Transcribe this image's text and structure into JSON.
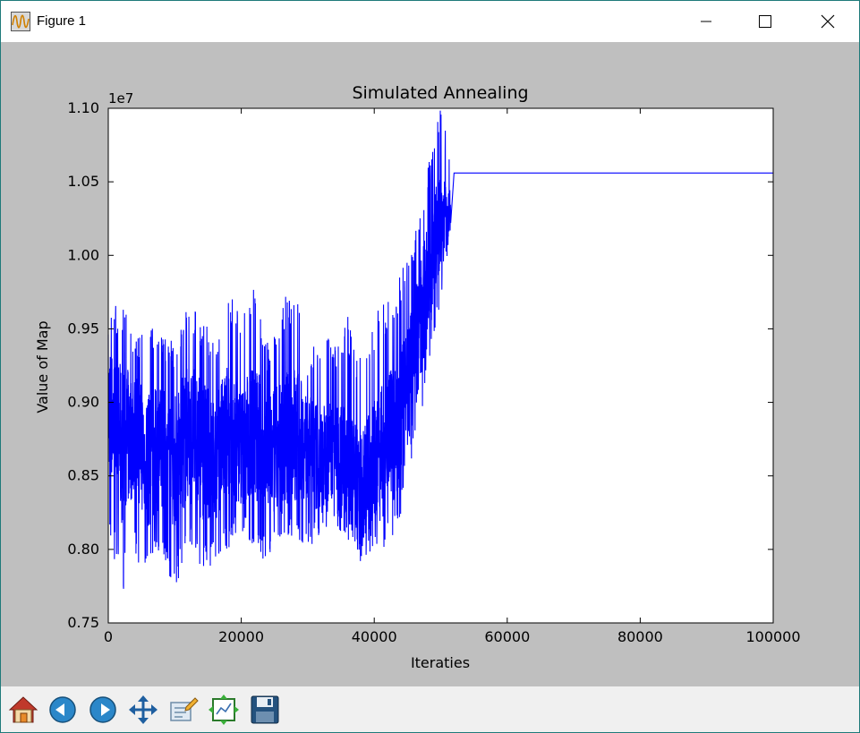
{
  "window": {
    "title": "Figure 1",
    "controls": [
      "minimize",
      "maximize",
      "close"
    ]
  },
  "toolbar": {
    "buttons": [
      {
        "name": "home-icon"
      },
      {
        "name": "back-icon"
      },
      {
        "name": "forward-icon"
      },
      {
        "name": "pan-icon"
      },
      {
        "name": "zoom-icon"
      },
      {
        "name": "configure-subplots-icon"
      },
      {
        "name": "save-icon"
      }
    ]
  },
  "chart_data": {
    "type": "line",
    "title": "Simulated Annealing",
    "xlabel": "Iteraties",
    "ylabel": "Value of Map",
    "offset_text": "1e7",
    "xlim": [
      0,
      100000
    ],
    "ylim": [
      0.75,
      1.1
    ],
    "xticks": [
      0,
      20000,
      40000,
      60000,
      80000,
      100000
    ],
    "yticks": [
      0.75,
      0.8,
      0.85,
      0.9,
      0.95,
      1.0,
      1.05,
      1.1
    ],
    "grid": false,
    "line_color": "#0000ff",
    "series": [
      {
        "x": [
          0,
          2000,
          4000,
          6000,
          8000,
          10000,
          12000,
          14000,
          16000,
          18000,
          20000,
          22000,
          24000,
          26000,
          28000,
          30000,
          32000,
          34000,
          36000,
          38000,
          40000,
          42000,
          44000,
          46000,
          48000,
          50000,
          51000,
          51500,
          52000,
          60000,
          80000,
          100000
        ],
        "y": [
          0.9,
          0.87,
          0.88,
          0.86,
          0.87,
          0.86,
          0.88,
          0.87,
          0.86,
          0.88,
          0.87,
          0.88,
          0.86,
          0.87,
          0.88,
          0.87,
          0.86,
          0.87,
          0.85,
          0.84,
          0.86,
          0.87,
          0.89,
          0.93,
          0.98,
          1.03,
          1.02,
          1.04,
          1.056,
          1.056,
          1.056,
          1.056
        ],
        "min": [
          0.81,
          0.77,
          0.79,
          0.79,
          0.8,
          0.77,
          0.8,
          0.78,
          0.79,
          0.8,
          0.81,
          0.8,
          0.79,
          0.8,
          0.81,
          0.8,
          0.81,
          0.82,
          0.8,
          0.79,
          0.8,
          0.8,
          0.82,
          0.87,
          0.91,
          0.97,
          1.0,
          1.02,
          1.056,
          1.056,
          1.056,
          1.056
        ],
        "max": [
          0.96,
          0.97,
          0.94,
          0.96,
          0.95,
          0.94,
          0.97,
          0.96,
          0.94,
          0.98,
          0.96,
          0.98,
          0.94,
          0.97,
          0.98,
          0.93,
          0.95,
          0.94,
          0.96,
          0.93,
          0.96,
          0.97,
          0.99,
          1.02,
          1.06,
          1.1,
          1.08,
          1.06,
          1.056,
          1.056,
          1.056,
          1.056
        ]
      }
    ]
  }
}
